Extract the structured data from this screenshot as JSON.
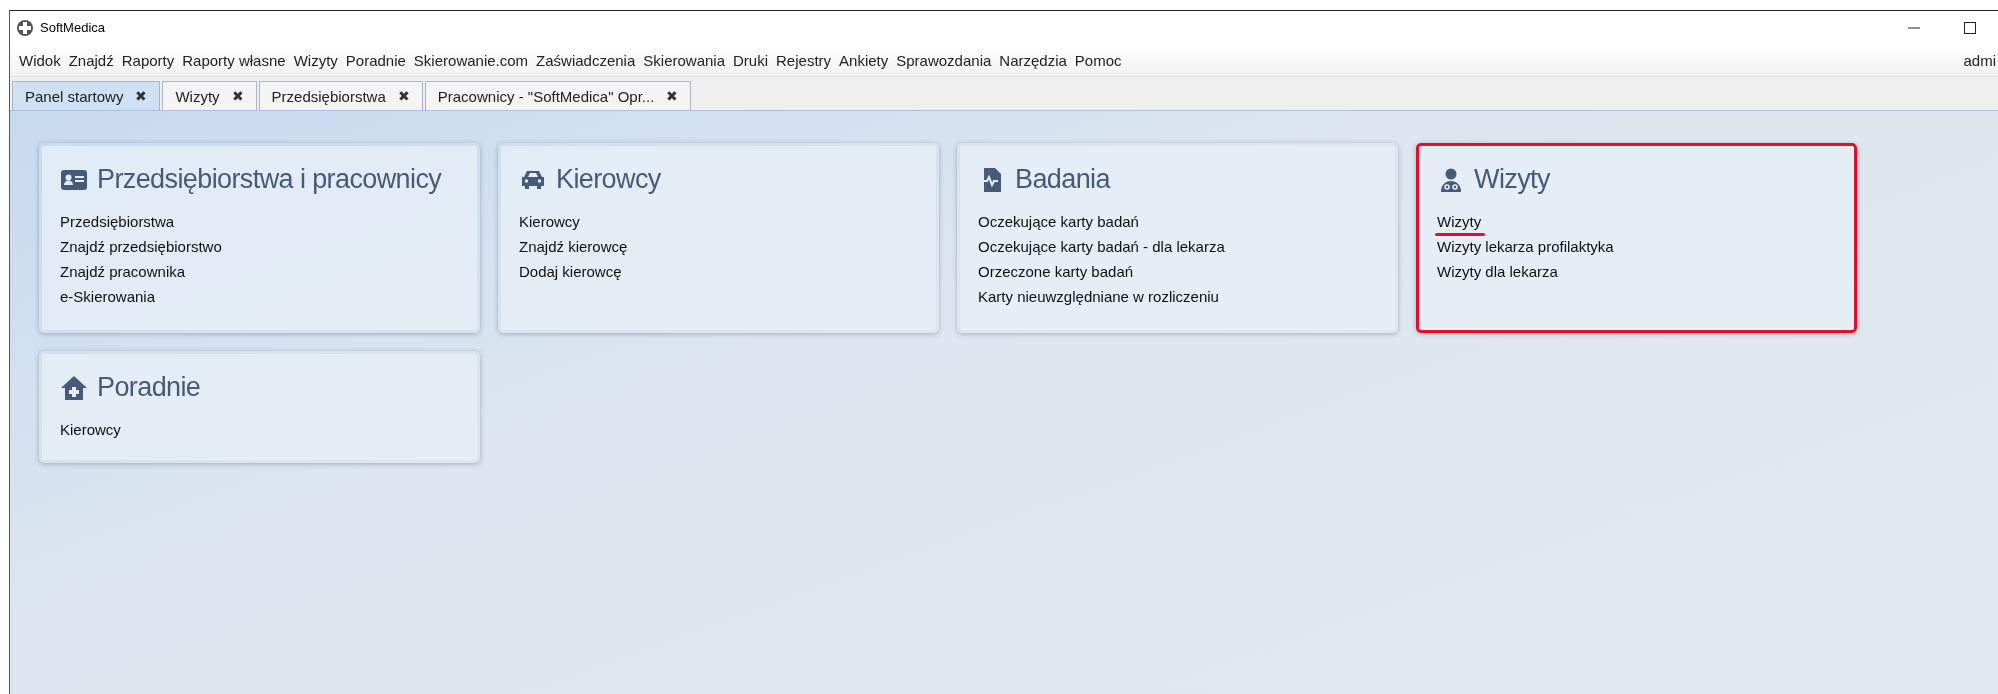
{
  "window": {
    "title": "SoftMedica"
  },
  "menu": [
    "Widok",
    "Znajdź",
    "Raporty",
    "Raporty własne",
    "Wizyty",
    "Poradnie",
    "Skierowanie.com",
    "Zaświadczenia",
    "Skierowania",
    "Druki",
    "Rejestry",
    "Ankiety",
    "Sprawozdania",
    "Narzędzia",
    "Pomoc"
  ],
  "user": "admi",
  "tabs": [
    {
      "label": "Panel startowy",
      "selected": true,
      "close": "✖"
    },
    {
      "label": "Wizyty",
      "selected": false,
      "close": "✖"
    },
    {
      "label": "Przedsiębiorstwa",
      "selected": false,
      "close": "✖"
    },
    {
      "label": "Pracownicy - \"SoftMedica\" Opr...",
      "selected": false,
      "close": "✖"
    }
  ],
  "cards": [
    {
      "kind": "id-card",
      "title": "Przedsiębiorstwa i pracownicy",
      "highlighted": false,
      "items": [
        {
          "label": "Przedsiębiorstwa",
          "underlined": false
        },
        {
          "label": "Znajdź przedsiębiorstwo",
          "underlined": false
        },
        {
          "label": "Znajdź pracownika",
          "underlined": false
        },
        {
          "label": "e-Skierowania",
          "underlined": false
        }
      ]
    },
    {
      "kind": "car",
      "title": "Kierowcy",
      "highlighted": false,
      "items": [
        {
          "label": "Kierowcy",
          "underlined": false
        },
        {
          "label": "Znajdź kierowcę",
          "underlined": false
        },
        {
          "label": "Dodaj kierowcę",
          "underlined": false
        }
      ]
    },
    {
      "kind": "medical-file",
      "title": "Badania",
      "highlighted": false,
      "items": [
        {
          "label": "Oczekujące karty badań",
          "underlined": false
        },
        {
          "label": "Oczekujące karty badań - dla lekarza",
          "underlined": false
        },
        {
          "label": "Orzeczone karty badań",
          "underlined": false
        },
        {
          "label": "Karty nieuwzględniane w rozliczeniu",
          "underlined": false
        }
      ]
    },
    {
      "kind": "doctor",
      "title": "Wizyty",
      "highlighted": true,
      "items": [
        {
          "label": "Wizyty",
          "underlined": true
        },
        {
          "label": "Wizyty lekarza profilaktyka",
          "underlined": false
        },
        {
          "label": "Wizyty dla lekarza",
          "underlined": false
        }
      ]
    },
    {
      "kind": "clinic",
      "title": "Poradnie",
      "highlighted": false,
      "items": [
        {
          "label": "Kierowcy",
          "underlined": false
        }
      ]
    }
  ]
}
